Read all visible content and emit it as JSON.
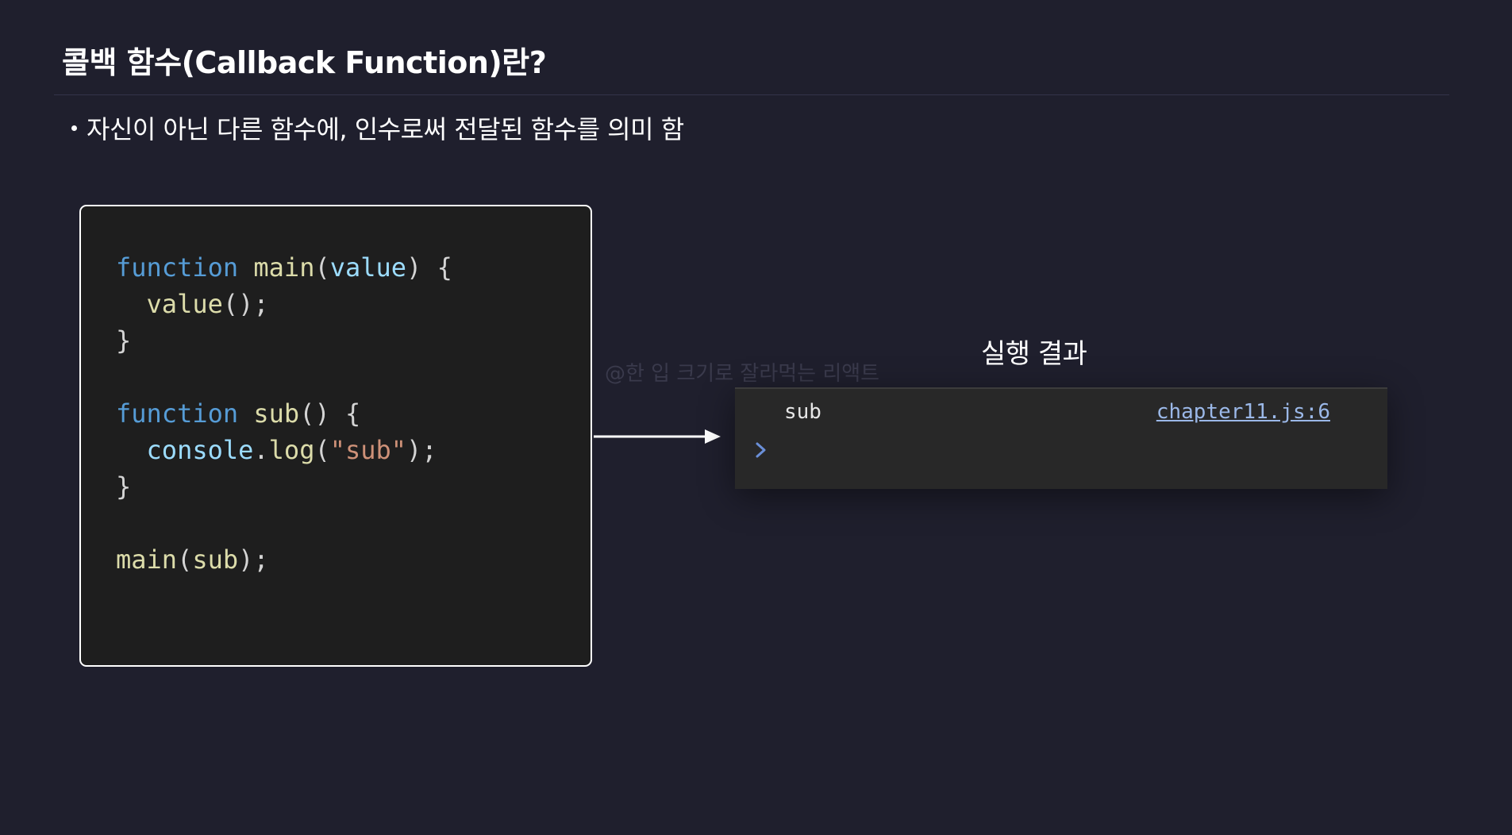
{
  "slide": {
    "title": "콜백 함수(Callback Function)란?",
    "bullet": "자신이 아닌 다른 함수에, 인수로써 전달된 함수를 의미 함",
    "watermark": "@한 입 크기로 잘라먹는 리액트",
    "result_label": "실행 결과"
  },
  "code": {
    "lines": [
      [
        {
          "t": "function",
          "c": "kw"
        },
        {
          "t": " ",
          "c": "pun"
        },
        {
          "t": "main",
          "c": "fn"
        },
        {
          "t": "(",
          "c": "pun"
        },
        {
          "t": "value",
          "c": "var"
        },
        {
          "t": ") {",
          "c": "pun"
        }
      ],
      [
        {
          "t": "  ",
          "c": "pun"
        },
        {
          "t": "value",
          "c": "fn"
        },
        {
          "t": "();",
          "c": "pun"
        }
      ],
      [
        {
          "t": "}",
          "c": "pun"
        }
      ],
      [],
      [
        {
          "t": "function",
          "c": "kw"
        },
        {
          "t": " ",
          "c": "pun"
        },
        {
          "t": "sub",
          "c": "fn"
        },
        {
          "t": "() {",
          "c": "pun"
        }
      ],
      [
        {
          "t": "  ",
          "c": "pun"
        },
        {
          "t": "console",
          "c": "var"
        },
        {
          "t": ".",
          "c": "pun"
        },
        {
          "t": "log",
          "c": "fn"
        },
        {
          "t": "(",
          "c": "pun"
        },
        {
          "t": "\"sub\"",
          "c": "str"
        },
        {
          "t": ");",
          "c": "pun"
        }
      ],
      [
        {
          "t": "}",
          "c": "pun"
        }
      ],
      [],
      [
        {
          "t": "main",
          "c": "fn"
        },
        {
          "t": "(",
          "c": "pun"
        },
        {
          "t": "sub",
          "c": "fn"
        },
        {
          "t": ");",
          "c": "pun"
        }
      ]
    ]
  },
  "console": {
    "message": "sub",
    "source": "chapter11.js:6",
    "prompt_icon": "chevron-right-icon",
    "prompt_color": "#6a8fd8"
  },
  "colors": {
    "background": "#1f1f2d",
    "code_background": "#1e1e1e",
    "keyword": "#569cd6",
    "function": "#dcdcaa",
    "variable": "#9cdcfe",
    "string": "#ce9178",
    "console_background": "#282828",
    "link": "#9bb8e8"
  }
}
